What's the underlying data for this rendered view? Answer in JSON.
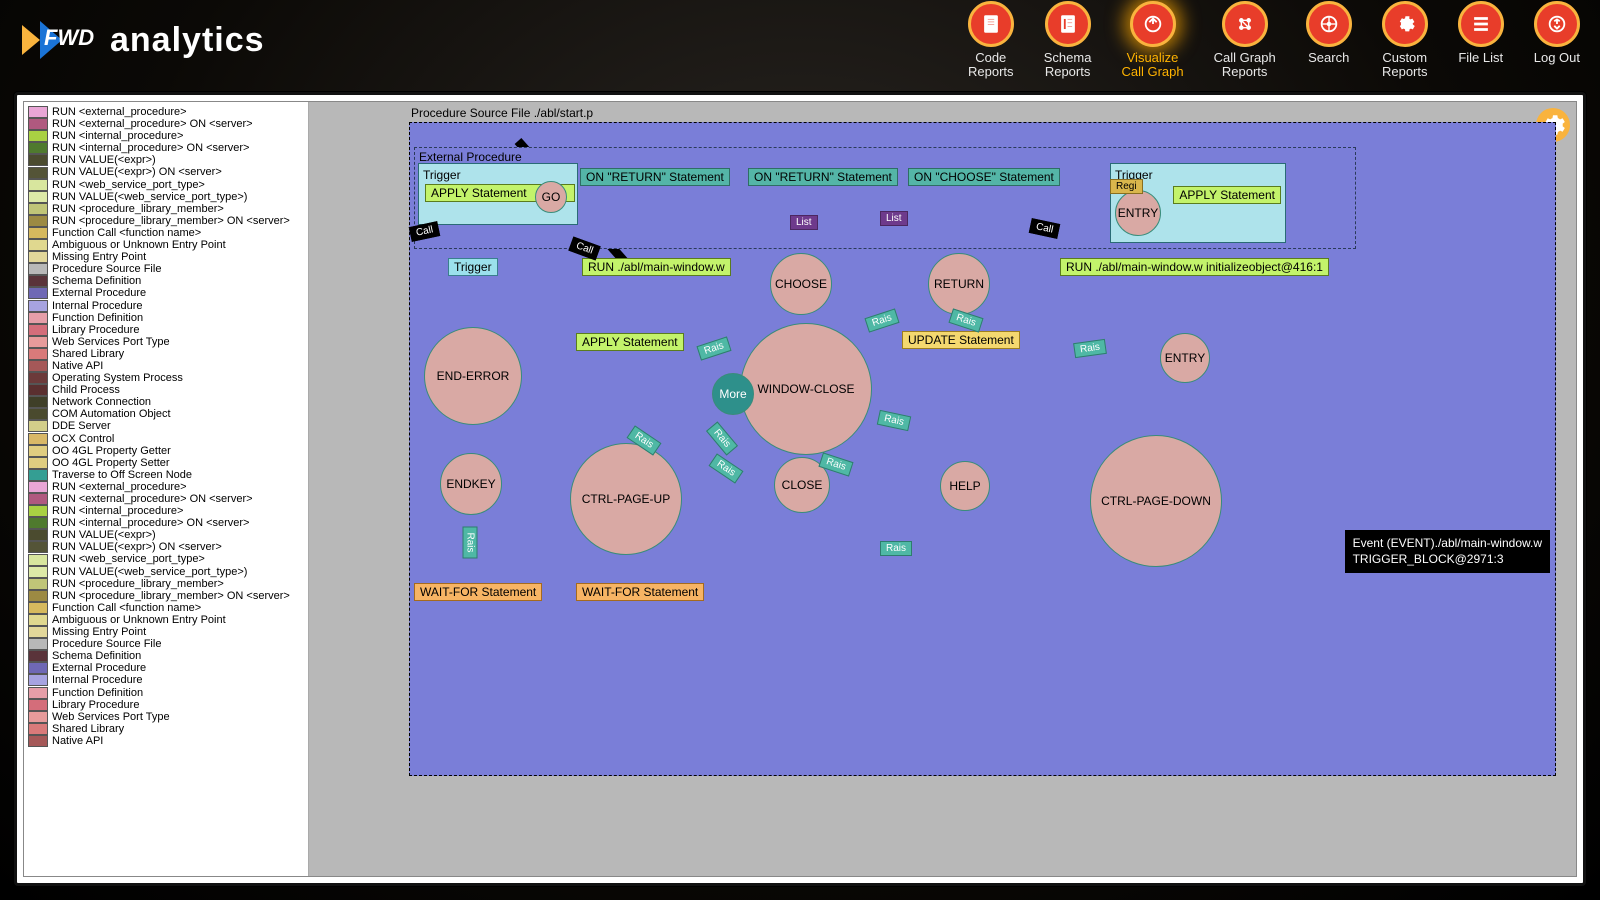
{
  "logo_text": "analytics",
  "nav": [
    {
      "label": "Code\nReports"
    },
    {
      "label": "Schema\nReports"
    },
    {
      "label": "Visualize\nCall Graph",
      "active": true
    },
    {
      "label": "Call Graph\nReports"
    },
    {
      "label": "Search"
    },
    {
      "label": "Custom\nReports"
    },
    {
      "label": "File List"
    },
    {
      "label": "Log Out"
    }
  ],
  "legend": [
    {
      "c": "#e9a6d6",
      "t": "RUN <external_procedure>"
    },
    {
      "c": "#b0597f",
      "t": "RUN <external_procedure> ON <server>"
    },
    {
      "c": "#a9d143",
      "t": "RUN <internal_procedure>"
    },
    {
      "c": "#4f7a2e",
      "t": "RUN <internal_procedure> ON <server>"
    },
    {
      "c": "#4b4b2f",
      "t": "RUN VALUE(<expr>)"
    },
    {
      "c": "#545437",
      "t": "RUN VALUE(<expr>) ON <server>"
    },
    {
      "c": "#d8e69e",
      "t": "RUN <web_service_port_type>"
    },
    {
      "c": "#dde9a7",
      "t": "RUN VALUE(<web_service_port_type>)"
    },
    {
      "c": "#c0c578",
      "t": "RUN <procedure_library_member>"
    },
    {
      "c": "#9c8a43",
      "t": "RUN <procedure_library_member> ON <server>"
    },
    {
      "c": "#d6b95e",
      "t": "Function Call <function name>"
    },
    {
      "c": "#e0d88f",
      "t": "Ambiguous or Unknown Entry Point"
    },
    {
      "c": "#e2d79a",
      "t": "Missing Entry Point"
    },
    {
      "c": "#b8b8b8",
      "t": "Procedure Source File"
    },
    {
      "c": "#5a333a",
      "t": "Schema Definition"
    },
    {
      "c": "#6f68b5",
      "t": "External Procedure"
    },
    {
      "c": "#a7a3e0",
      "t": "Internal Procedure"
    },
    {
      "c": "#e59ea8",
      "t": "Function Definition"
    },
    {
      "c": "#d46d7a",
      "t": "Library Procedure"
    },
    {
      "c": "#e79b9b",
      "t": "Web Services Port Type"
    },
    {
      "c": "#d97a7a",
      "t": "Shared Library"
    },
    {
      "c": "#a55858",
      "t": "Native API"
    },
    {
      "c": "#6c3a3a",
      "t": "Operating System Process"
    },
    {
      "c": "#5a2f2f",
      "t": "Child Process"
    },
    {
      "c": "#3f3f28",
      "t": "Network Connection"
    },
    {
      "c": "#4a4a2e",
      "t": "COM Automation Object"
    },
    {
      "c": "#d2ce8a",
      "t": "DDE Server"
    },
    {
      "c": "#d9b867",
      "t": "OCX Control"
    },
    {
      "c": "#e0cd80",
      "t": "OO 4GL Property Getter"
    },
    {
      "c": "#e0cd80",
      "t": "OO 4GL Property Setter"
    },
    {
      "c": "#349e93",
      "t": "Traverse to Off Screen Node"
    },
    {
      "c": "#e9a6d6",
      "t": "RUN <external_procedure>"
    },
    {
      "c": "#b0597f",
      "t": "RUN <external_procedure> ON <server>"
    },
    {
      "c": "#a9d143",
      "t": "RUN <internal_procedure>"
    },
    {
      "c": "#4f7a2e",
      "t": "RUN <internal_procedure> ON <server>"
    },
    {
      "c": "#4b4b2f",
      "t": "RUN VALUE(<expr>)"
    },
    {
      "c": "#545437",
      "t": "RUN VALUE(<expr>) ON <server>"
    },
    {
      "c": "#d8e69e",
      "t": "RUN <web_service_port_type>"
    },
    {
      "c": "#dde9a7",
      "t": "RUN VALUE(<web_service_port_type>)"
    },
    {
      "c": "#c0c578",
      "t": "RUN <procedure_library_member>"
    },
    {
      "c": "#9c8a43",
      "t": "RUN <procedure_library_member> ON <server>"
    },
    {
      "c": "#d6b95e",
      "t": "Function Call <function name>"
    },
    {
      "c": "#e0d88f",
      "t": "Ambiguous or Unknown Entry Point"
    },
    {
      "c": "#e2d79a",
      "t": "Missing Entry Point"
    },
    {
      "c": "#b8b8b8",
      "t": "Procedure Source File"
    },
    {
      "c": "#5a333a",
      "t": "Schema Definition"
    },
    {
      "c": "#6f68b5",
      "t": "External Procedure"
    },
    {
      "c": "#a7a3e0",
      "t": "Internal Procedure"
    },
    {
      "c": "#e59ea8",
      "t": "Function Definition"
    },
    {
      "c": "#d46d7a",
      "t": "Library Procedure"
    },
    {
      "c": "#e79b9b",
      "t": "Web Services Port Type"
    },
    {
      "c": "#d97a7a",
      "t": "Shared Library"
    },
    {
      "c": "#a55858",
      "t": "Native API"
    }
  ],
  "graph": {
    "title": "Procedure Source File ./abl/start.p",
    "regionA_title": "External Procedure",
    "trigger": "Trigger",
    "apply": "APPLY Statement",
    "on_return": "ON \"RETURN\" Statement",
    "on_return2": "ON \"RETURN\" Statement",
    "on_choose": "ON \"CHOOSE\" Statement",
    "more": "More",
    "go": "GO",
    "choose": "CHOOSE",
    "return": "RETURN",
    "entry": "ENTRY",
    "end_error": "END-ERROR",
    "window_close": "WINDOW-CLOSE",
    "update": "UPDATE Statement",
    "ctrl_up": "CTRL-PAGE-UP",
    "endkey": "ENDKEY",
    "close": "CLOSE",
    "help": "HELP",
    "ctrl_down": "CTRL-PAGE-DOWN",
    "waitfor": "WAIT-FOR Statement",
    "waitfor2": "WAIT-FOR Statement",
    "run1": "RUN ./abl/main-window.w",
    "run2": "RUN ./abl/main-window.w initializeobject@416:1",
    "tooltip": "Event (EVENT)./abl/main-window.w\nTRIGGER_BLOCK@2971:3",
    "edge_call": "Call",
    "edge_list": "List",
    "edge_rais": "Rais",
    "edge_regi": "Regi"
  }
}
